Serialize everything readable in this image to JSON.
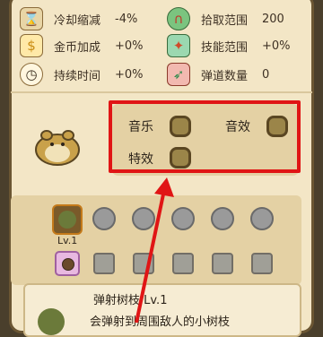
{
  "stats_left": [
    {
      "icon": "hourglass-icon",
      "label": "冷却缩减",
      "value": "-4%"
    },
    {
      "icon": "gold-coin-icon",
      "label": "金币加成",
      "value": "+0%"
    },
    {
      "icon": "clock-icon",
      "label": "持续时间",
      "value": "+0%"
    }
  ],
  "stats_right": [
    {
      "icon": "magnet-icon",
      "label": "拾取范围",
      "value": "200"
    },
    {
      "icon": "skill-range-icon",
      "label": "技能范围",
      "value": "+0%"
    },
    {
      "icon": "projectile-icon",
      "label": "弹道数量",
      "value": "0"
    }
  ],
  "settings": {
    "music_label": "音乐",
    "sound_label": "音效",
    "effects_label": "特效"
  },
  "weapon": {
    "level": "Lv.1",
    "card_title": "弹射树枝 Lv.1",
    "card_desc": "会弹射到周围敌人的小树枝"
  },
  "colors": {
    "highlight": "#e01515",
    "panel": "#f3e6c6",
    "toggle_on": "#9b8549"
  }
}
